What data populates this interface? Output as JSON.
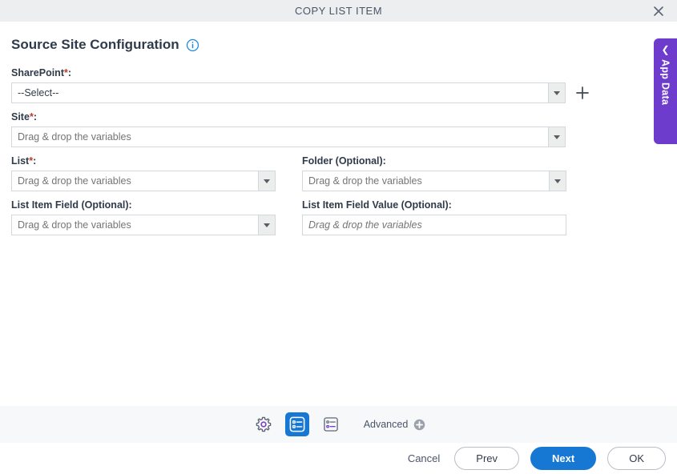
{
  "window": {
    "title": "COPY LIST ITEM",
    "close_icon": "close-icon"
  },
  "section": {
    "title": "Source Site Configuration",
    "info_icon": "info-icon"
  },
  "form": {
    "sharepoint": {
      "label": "SharePoint",
      "required_mark": "*",
      "suffix": ":",
      "value": "--Select--",
      "dropdown_icon": "chevron-down-icon",
      "add_icon": "plus-icon"
    },
    "site": {
      "label": "Site",
      "required_mark": "*",
      "suffix": ":",
      "placeholder": "Drag & drop the variables",
      "dropdown_icon": "chevron-down-icon"
    },
    "list": {
      "label": "List",
      "required_mark": "*",
      "suffix": ":",
      "placeholder": "Drag & drop the variables",
      "dropdown_icon": "chevron-down-icon"
    },
    "folder": {
      "label": "Folder (Optional):",
      "placeholder": "Drag & drop the variables",
      "dropdown_icon": "chevron-down-icon"
    },
    "list_item_field": {
      "label": "List Item Field (Optional):",
      "placeholder": "Drag & drop the variables",
      "dropdown_icon": "chevron-down-icon"
    },
    "list_item_field_value": {
      "label": "List Item Field Value (Optional):",
      "placeholder": "Drag & drop the variables"
    }
  },
  "app_data_tab": {
    "label": "App Data",
    "collapse_icon": "chevron-left-icon"
  },
  "toolbar": {
    "items": [
      {
        "name": "settings-icon",
        "active": false
      },
      {
        "name": "form-list-icon",
        "active": true
      },
      {
        "name": "form-fields-icon",
        "active": false
      }
    ],
    "advanced_label": "Advanced",
    "advanced_icon": "plus-circle-icon"
  },
  "footer": {
    "cancel": "Cancel",
    "prev": "Prev",
    "next": "Next",
    "ok": "OK"
  },
  "colors": {
    "accent_blue": "#1778d4",
    "app_data_purple": "#6d3ccd",
    "required_red": "#c0392b",
    "titlebar_gray": "#edeef0",
    "toolband_gray": "#f7f8fa"
  }
}
